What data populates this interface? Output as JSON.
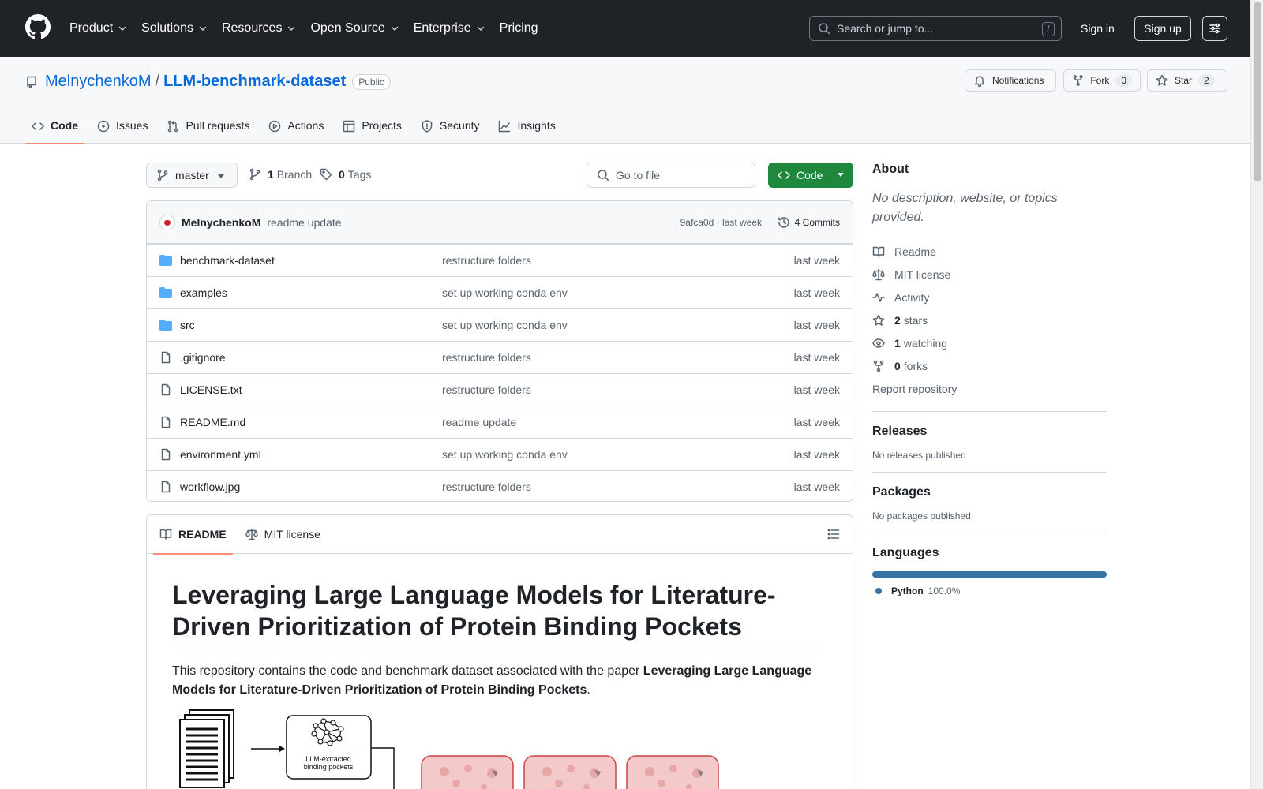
{
  "header": {
    "nav": [
      "Product",
      "Solutions",
      "Resources",
      "Open Source",
      "Enterprise",
      "Pricing"
    ],
    "search_placeholder": "Search or jump to...",
    "search_shortcut": "/",
    "signin": "Sign in",
    "signup": "Sign up"
  },
  "repo": {
    "owner": "MelnychenkoM",
    "separator": "/",
    "name": "LLM-benchmark-dataset",
    "visibility": "Public",
    "notifications": "Notifications",
    "fork_label": "Fork",
    "fork_count": "0",
    "star_label": "Star",
    "star_count": "2",
    "tabs": [
      "Code",
      "Issues",
      "Pull requests",
      "Actions",
      "Projects",
      "Security",
      "Insights"
    ]
  },
  "toolbar": {
    "branch": "master",
    "branches_count": "1",
    "branches_label": "Branch",
    "tags_count": "0",
    "tags_label": "Tags",
    "goto_placeholder": "Go to file",
    "code_label": "Code"
  },
  "commit": {
    "author": "MelnychenkoM",
    "message": "readme update",
    "sha": "9afca0d · last week",
    "commits": "4 Commits"
  },
  "files": [
    {
      "type": "folder",
      "name": "benchmark-dataset",
      "message": "restructure folders",
      "date": "last week"
    },
    {
      "type": "folder",
      "name": "examples",
      "message": "set up working conda env",
      "date": "last week"
    },
    {
      "type": "folder",
      "name": "src",
      "message": "set up working conda env",
      "date": "last week"
    },
    {
      "type": "file",
      "name": ".gitignore",
      "message": "restructure folders",
      "date": "last week"
    },
    {
      "type": "file",
      "name": "LICENSE.txt",
      "message": "restructure folders",
      "date": "last week"
    },
    {
      "type": "file",
      "name": "README.md",
      "message": "readme update",
      "date": "last week"
    },
    {
      "type": "file",
      "name": "environment.yml",
      "message": "set up working conda env",
      "date": "last week"
    },
    {
      "type": "file",
      "name": "workflow.jpg",
      "message": "restructure folders",
      "date": "last week"
    }
  ],
  "readme": {
    "tab_readme": "README",
    "tab_license": "MIT license",
    "title": "Leveraging Large Language Models for Literature-Driven Prioritization of Protein Binding Pockets",
    "intro_prefix": "This repository contains the code and benchmark dataset associated with the paper ",
    "intro_bold": "Leveraging Large Language Models for Literature-Driven Prioritization of Protein Binding Pockets",
    "intro_suffix": ".",
    "workflow_caption_1": "LLM-extracted",
    "workflow_caption_2": "binding pockets"
  },
  "about": {
    "heading": "About",
    "description": "No description, website, or topics provided.",
    "readme": "Readme",
    "license": "MIT license",
    "activity": "Activity",
    "stars_count": "2",
    "stars_label": "stars",
    "watching_count": "1",
    "watching_label": "watching",
    "forks_count": "0",
    "forks_label": "forks",
    "report": "Report repository"
  },
  "releases": {
    "heading": "Releases",
    "text": "No releases published"
  },
  "packages": {
    "heading": "Packages",
    "text": "No packages published"
  },
  "languages": {
    "heading": "Languages",
    "name": "Python",
    "percent": "100.0%",
    "color": "#3572A5"
  }
}
